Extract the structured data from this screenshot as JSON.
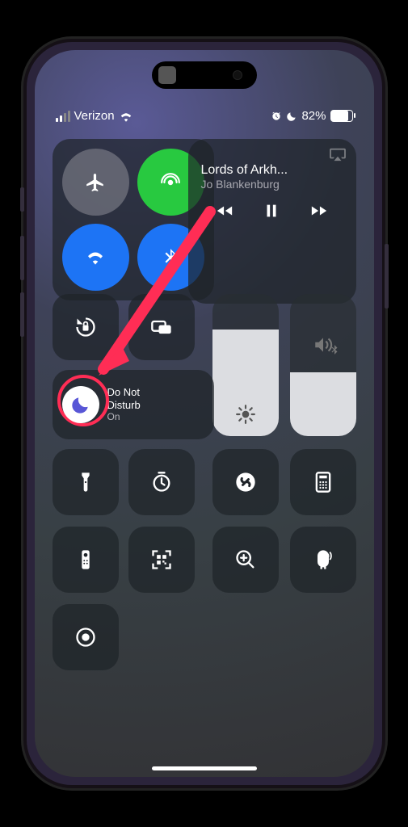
{
  "status": {
    "carrier": "Verizon",
    "battery_pct": "82%"
  },
  "media": {
    "title": "Lords of Arkh...",
    "artist": "Jo Blankenburg"
  },
  "focus": {
    "label_line1": "Do Not",
    "label_line2": "Disturb",
    "state": "On"
  },
  "sliders": {
    "brightness_pct": 75,
    "volume_pct": 45
  },
  "icons": {
    "airplane": "airplane-icon",
    "airdrop": "airdrop-icon",
    "wifi": "wifi-icon",
    "bluetooth": "bluetooth-icon",
    "orientation_lock": "orientation-lock-icon",
    "screen_mirroring": "screen-mirroring-icon",
    "moon": "moon-icon",
    "brightness": "brightness-icon",
    "volume": "volume-icon",
    "flashlight": "flashlight-icon",
    "timer": "timer-icon",
    "shazam": "shazam-icon",
    "calculator": "calculator-icon",
    "remote": "remote-icon",
    "qr": "qr-scanner-icon",
    "magnifier": "magnifier-icon",
    "sound_recognition": "sound-recognition-icon",
    "screen_record": "screen-record-icon",
    "alarm": "alarm-icon",
    "airplay_audio": "airplay-audio-icon"
  }
}
